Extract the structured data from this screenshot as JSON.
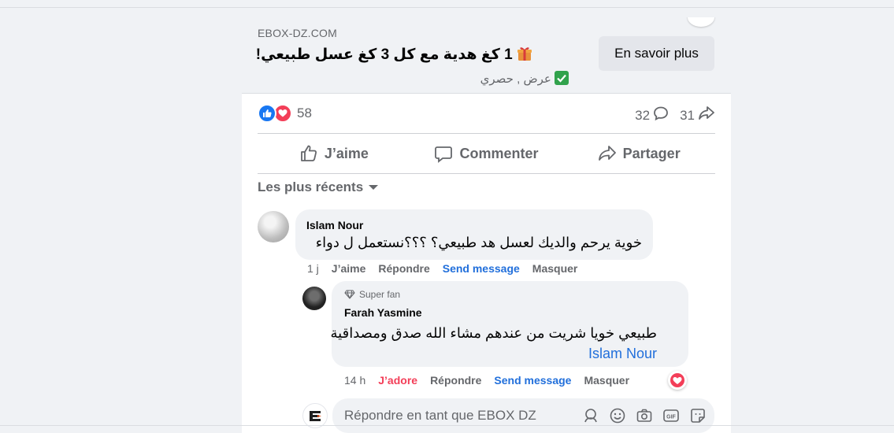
{
  "ad": {
    "domain": "EBOX-DZ.COM",
    "headline": "1 كغ هدية مع كل 3 كغ عسل طبيعي!",
    "subline": "عرض , حصري",
    "cta": "En savoir plus"
  },
  "stats": {
    "reaction_count": "58",
    "comments_count": "32",
    "shares_count": "31"
  },
  "actions": {
    "like": "J’aime",
    "comment": "Commenter",
    "share": "Partager"
  },
  "sort": {
    "label": "Les plus récents"
  },
  "comments": [
    {
      "author": "Islam Nour",
      "text": "خوية يرحم والديك لعسل هد طبيعي؟ ؟؟؟نستعمل ل دواء",
      "time": "1 j",
      "like": "J’aime",
      "reply": "Répondre",
      "send": "Send message",
      "hide": "Masquer"
    },
    {
      "badge": "Super fan",
      "author": "Farah Yasmine",
      "mention": "Islam Nour",
      "text": "طبيعي خويا شريت من عندهم مشاء الله صدق ومصداقية",
      "time": "14 h",
      "like": "J’adore",
      "reply": "Répondre",
      "send": "Send message",
      "hide": "Masquer"
    }
  ],
  "reply_box": {
    "placeholder": "Répondre en tant que EBOX DZ"
  },
  "colors": {
    "like_blue": "#1877f2",
    "love_red": "#f33e58",
    "link_blue": "#216fdb",
    "muted": "#65676b"
  }
}
